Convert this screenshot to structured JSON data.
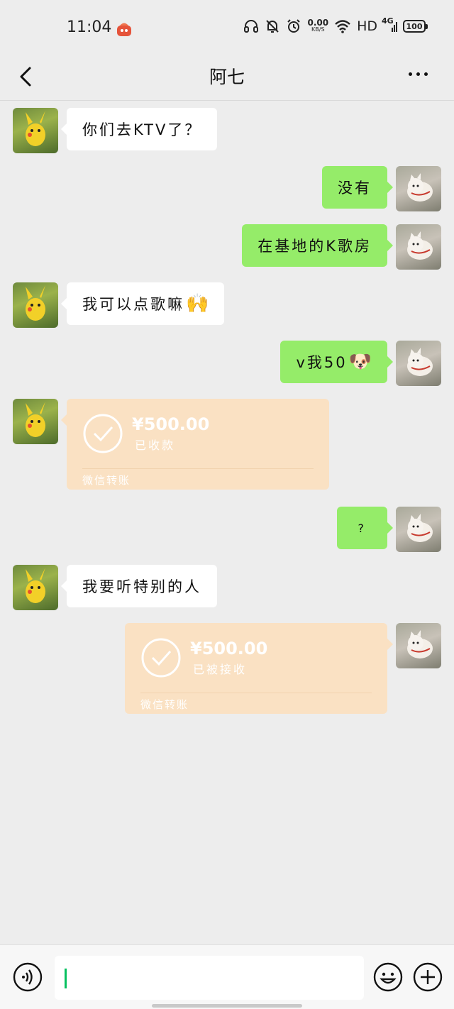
{
  "status_bar": {
    "time": "11:04",
    "net_speed_value": "0.00",
    "net_speed_unit": "KB/S",
    "hd": "HD",
    "signal": "4G",
    "battery": "100"
  },
  "header": {
    "title": "阿七",
    "back_icon": "chevron-left-icon",
    "more_icon": "more-dots-icon"
  },
  "messages": [
    {
      "side": "left",
      "type": "text",
      "text": "你们去KTV了？"
    },
    {
      "side": "right",
      "type": "text",
      "text": "没有"
    },
    {
      "side": "right",
      "type": "text",
      "text": "在基地的K歌房"
    },
    {
      "side": "left",
      "type": "text",
      "text": "我可以点歌嘛",
      "emoji": "🙌"
    },
    {
      "side": "right",
      "type": "text",
      "text": "v我50",
      "emoji": "🐶"
    },
    {
      "side": "left",
      "type": "transfer",
      "amount": "¥500.00",
      "status": "已收款",
      "footer": "微信转账"
    },
    {
      "side": "right",
      "type": "text",
      "text": "?"
    },
    {
      "side": "left",
      "type": "text",
      "text": "我要听特别的人"
    },
    {
      "side": "right",
      "type": "transfer",
      "amount": "¥500.00",
      "status": "已被接收",
      "footer": "微信转账"
    }
  ],
  "input_bar": {
    "text_value": "",
    "icons": [
      "voice-icon",
      "emoji-icon",
      "plus-icon"
    ]
  },
  "colors": {
    "background": "#ededed",
    "my_bubble": "#95ec69",
    "their_bubble": "#ffffff",
    "transfer_card": "#fae1c3",
    "cursor": "#07c160"
  }
}
